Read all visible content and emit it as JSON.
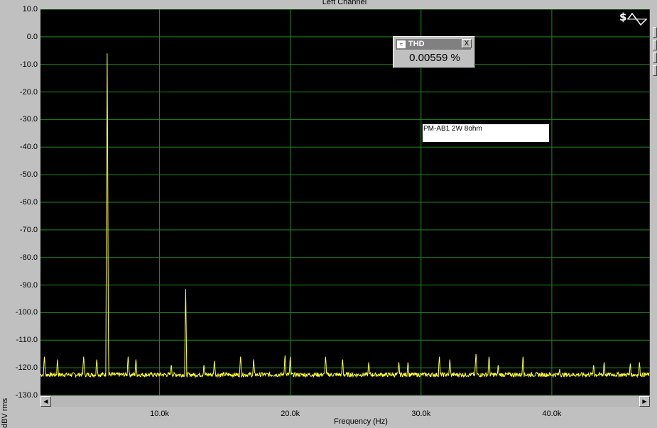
{
  "chart_data": {
    "type": "line",
    "title": "Left Channel",
    "xlabel": "Frequency (Hz)",
    "ylabel": "dBV rms",
    "xlim": [
      900,
      47500
    ],
    "ylim": [
      -130,
      10
    ],
    "yticks": [
      "10.0",
      "0.0",
      "-10.0",
      "-20.0",
      "-30.0",
      "-40.0",
      "-50.0",
      "-60.0",
      "-70.0",
      "-80.0",
      "-90.0",
      "-100.0",
      "-110.0",
      "-120.0",
      "-130.0"
    ],
    "ytick_values": [
      10,
      0,
      -10,
      -20,
      -30,
      -40,
      -50,
      -60,
      -70,
      -80,
      -90,
      -100,
      -110,
      -120,
      -130
    ],
    "xticks": [
      "10.0k",
      "20.0k",
      "30.0k",
      "40.0k"
    ],
    "xtick_values": [
      10000,
      20000,
      30000,
      40000
    ],
    "x_gridlines": [
      10000,
      20000,
      30000,
      40000,
      47500
    ],
    "grid": true,
    "series": [
      {
        "color": "#ffff33",
        "noise_floor": -122.5,
        "peaks": [
          {
            "x": 6000,
            "y": -6.0
          },
          {
            "x": 12000,
            "y": -91.5
          },
          {
            "x": 1200,
            "y": -116
          },
          {
            "x": 2200,
            "y": -117
          },
          {
            "x": 4200,
            "y": -116
          },
          {
            "x": 5200,
            "y": -117
          },
          {
            "x": 7600,
            "y": -116
          },
          {
            "x": 8200,
            "y": -117
          },
          {
            "x": 10900,
            "y": -119
          },
          {
            "x": 13400,
            "y": -119
          },
          {
            "x": 14200,
            "y": -117.5
          },
          {
            "x": 16200,
            "y": -116
          },
          {
            "x": 17200,
            "y": -117
          },
          {
            "x": 19600,
            "y": -115.5
          },
          {
            "x": 20000,
            "y": -116
          },
          {
            "x": 22700,
            "y": -116
          },
          {
            "x": 24000,
            "y": -117
          },
          {
            "x": 26000,
            "y": -118
          },
          {
            "x": 28300,
            "y": -118
          },
          {
            "x": 29000,
            "y": -118
          },
          {
            "x": 31400,
            "y": -116
          },
          {
            "x": 32200,
            "y": -117
          },
          {
            "x": 34200,
            "y": -115
          },
          {
            "x": 35200,
            "y": -116
          },
          {
            "x": 35900,
            "y": -119
          },
          {
            "x": 37800,
            "y": -116
          },
          {
            "x": 40600,
            "y": -120.5
          },
          {
            "x": 43200,
            "y": -119
          },
          {
            "x": 44000,
            "y": -118
          },
          {
            "x": 46000,
            "y": -118.5
          },
          {
            "x": 46700,
            "y": -118
          }
        ]
      }
    ]
  },
  "thd_widget": {
    "title": "THD",
    "value": "0.00559 %",
    "close_label": "X"
  },
  "annotation": {
    "text": "PM-AB1  2W 8ohm"
  },
  "scrollbar": {
    "left_arrow": "◀",
    "right_arrow": "▶"
  },
  "colors": {
    "plot_bg": "#000000",
    "grid": "#1f8a1f",
    "trace": "#ffff33"
  }
}
